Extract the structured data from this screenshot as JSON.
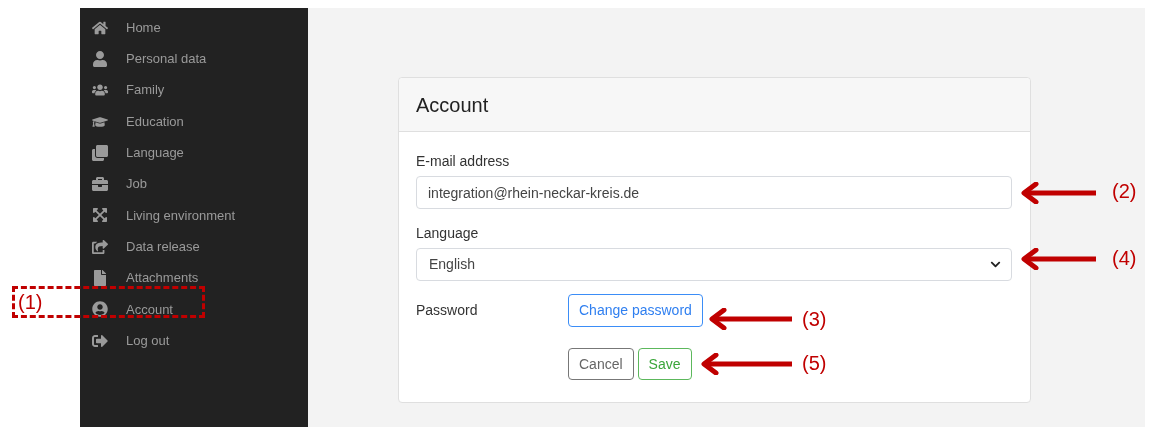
{
  "sidebar": {
    "items": [
      {
        "label": "Home"
      },
      {
        "label": "Personal data"
      },
      {
        "label": "Family"
      },
      {
        "label": "Education"
      },
      {
        "label": "Language"
      },
      {
        "label": "Job"
      },
      {
        "label": "Living environment"
      },
      {
        "label": "Data release"
      },
      {
        "label": "Attachments"
      },
      {
        "label": "Account"
      },
      {
        "label": "Log out"
      }
    ]
  },
  "card": {
    "title": "Account",
    "email": {
      "label": "E-mail address",
      "value": "integration@rhein-neckar-kreis.de"
    },
    "language": {
      "label": "Language",
      "value": "English"
    },
    "password": {
      "label": "Password",
      "button": "Change password"
    },
    "buttons": [
      {
        "label": "Cancel",
        "kind": "secondary"
      },
      {
        "label": "Save",
        "kind": "success"
      }
    ]
  },
  "annotations": [
    {
      "label": "(1)",
      "kind": "box"
    },
    {
      "label": "(2)",
      "kind": "arrow"
    },
    {
      "label": "(4)",
      "kind": "arrow"
    },
    {
      "label": "(3)",
      "kind": "arrow"
    },
    {
      "label": "(5)",
      "kind": "arrow"
    }
  ]
}
